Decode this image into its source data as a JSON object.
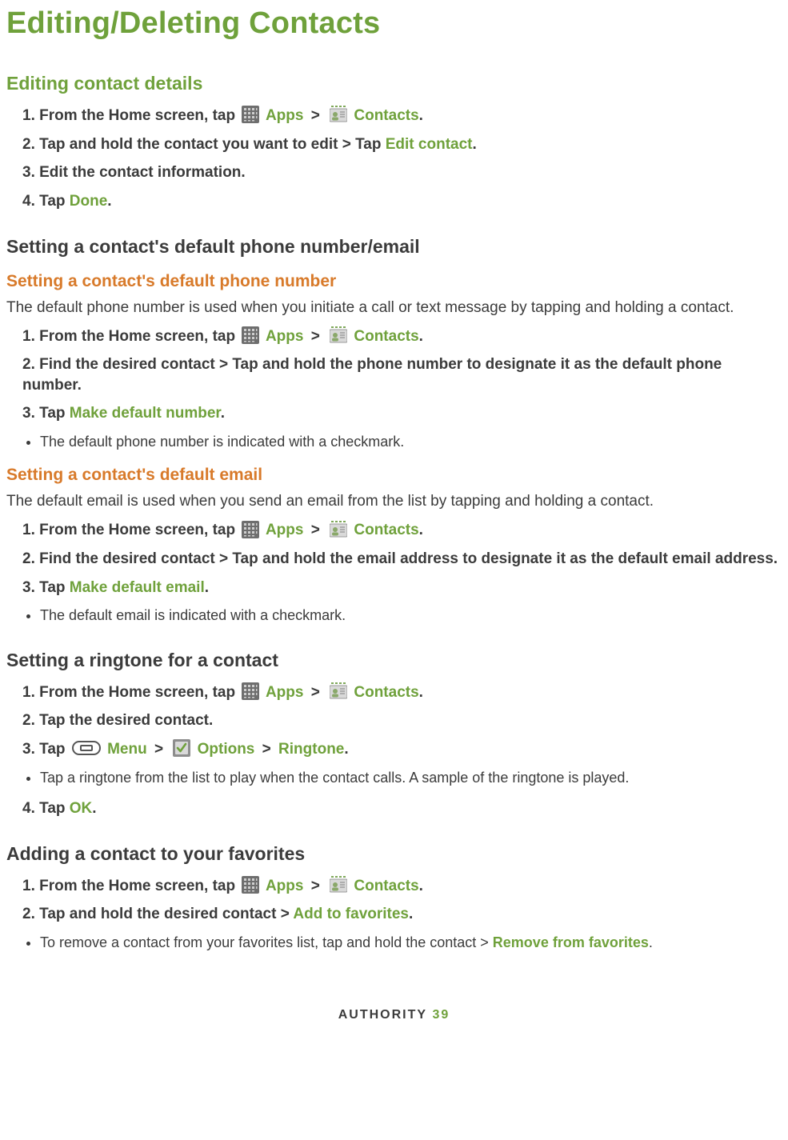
{
  "page": {
    "title": "Editing/Deleting Contacts",
    "footer_brand": "AUTHORITY",
    "footer_page": "39"
  },
  "labels": {
    "apps": "Apps",
    "contacts": "Contacts",
    "edit_contact": "Edit contact",
    "done": "Done",
    "make_default_number": "Make default number",
    "make_default_email": "Make default email",
    "menu": "Menu",
    "options": "Options",
    "ringtone": "Ringtone",
    "ok": "OK",
    "add_to_favorites": "Add to favorites",
    "remove_from_favorites": "Remove from favorites"
  },
  "sections": {
    "editing_details": {
      "heading": "Editing contact details",
      "steps": {
        "s1_pre": "1. From the Home screen, tap ",
        "s2_pre": "2. Tap and hold the contact you want to edit > Tap ",
        "s3": "3. Edit the contact information.",
        "s4_pre": "4. Tap "
      }
    },
    "default_group": {
      "heading": "Setting a contact's default phone number/email",
      "phone": {
        "heading": "Setting a contact's default phone number",
        "intro": "The default phone number is used when you initiate a call or text message by tapping and holding a contact.",
        "steps": {
          "s1_pre": "1. From the Home screen, tap ",
          "s2": "2. Find the desired contact > Tap and hold the phone number to designate it as the default phone number.",
          "s3_pre": "3. Tap "
        },
        "bullet": "The default phone number is indicated with a checkmark."
      },
      "email": {
        "heading": "Setting a contact's default email",
        "intro": "The default email is used when you send an email from the list by tapping and holding a contact.",
        "steps": {
          "s1_pre": "1. From the Home screen, tap ",
          "s2": "2. Find the desired contact > Tap and hold the email address to designate it as the default email address.",
          "s3_pre": "3. Tap "
        },
        "bullet": "The default email is indicated with a checkmark."
      }
    },
    "ringtone": {
      "heading": "Setting a ringtone for a contact",
      "steps": {
        "s1_pre": "1. From the Home screen, tap ",
        "s2": "2. Tap the desired contact.",
        "s3_pre": "3. Tap ",
        "s4_pre": "4. Tap "
      },
      "bullet": "Tap a ringtone from the list to play when the contact calls. A sample of the ringtone is played."
    },
    "favorites": {
      "heading": "Adding a contact to your favorites",
      "steps": {
        "s1_pre": "1. From the Home screen, tap ",
        "s2_pre": "2. Tap and hold the desired contact > "
      },
      "bullet_pre": "To remove a contact from your favorites list, tap and hold the contact > "
    }
  },
  "icons": {
    "apps": "apps-grid-icon",
    "contacts": "contacts-card-icon",
    "menu": "menu-key-icon",
    "options": "options-check-icon"
  }
}
